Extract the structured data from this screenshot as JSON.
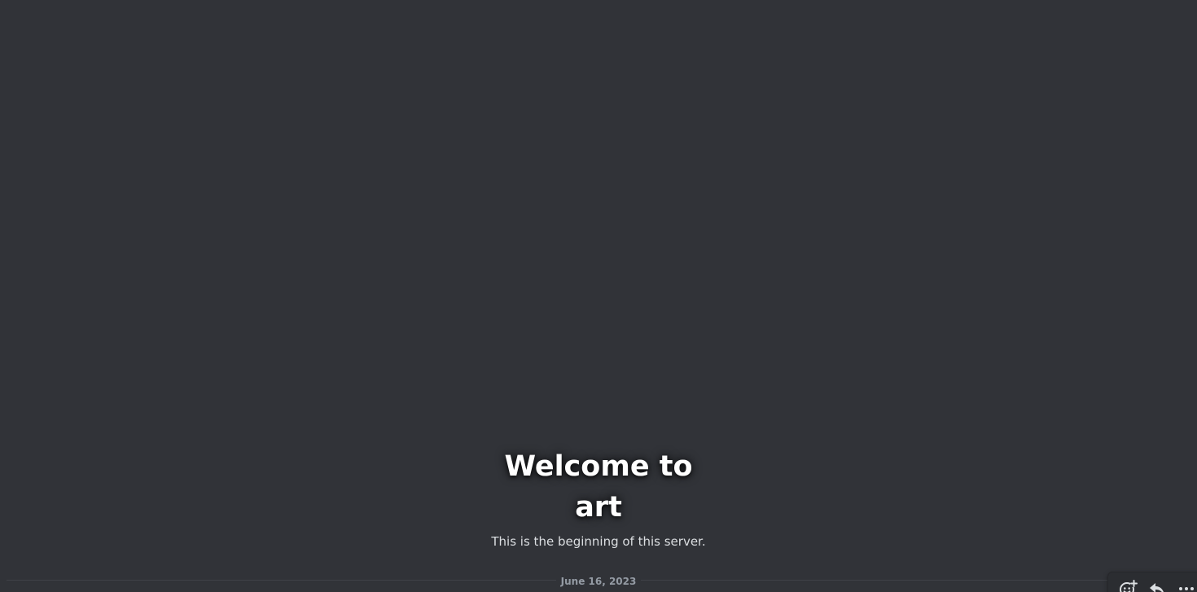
{
  "welcome": {
    "title": "Welcome to art",
    "subtitle": "This is the beginning of this server."
  },
  "divider": {
    "date": "June 16, 2023"
  },
  "toolbar": {
    "buttons": [
      {
        "icon": "add-reaction-icon"
      },
      {
        "icon": "reply-icon"
      },
      {
        "icon": "more-options-icon"
      }
    ]
  },
  "colors": {
    "background": "#313338",
    "title": "#ffffff",
    "subtitle": "#dbdee1",
    "muted": "#949ba4",
    "toolbar": "#2b2d31"
  }
}
